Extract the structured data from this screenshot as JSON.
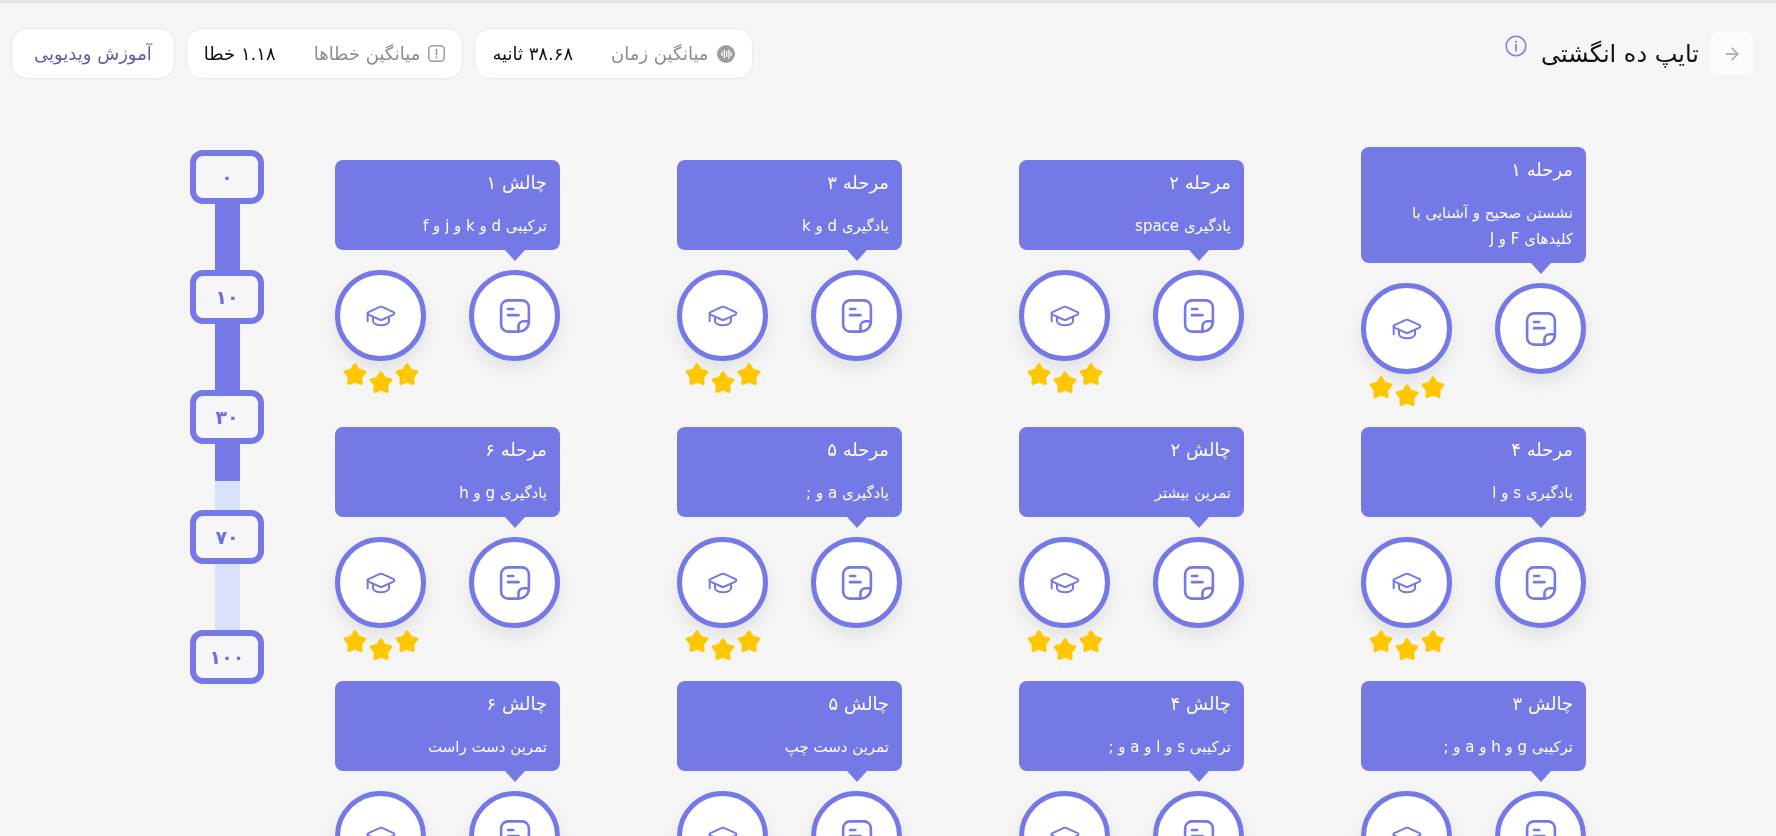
{
  "header": {
    "title": "تایپ ده انگشتی",
    "stats": [
      {
        "kind": "time",
        "label": "میانگین زمان",
        "value": "۳۸.۶۸ ثانیه"
      },
      {
        "kind": "errors",
        "label": "میانگین خطاها",
        "value": "۱.۱۸ خطا"
      }
    ],
    "video_button": "آموزش ویدیویی"
  },
  "stages": [
    {
      "title": "مرحله ۱",
      "subtitle": "نشستن صحیح و آشنایی با کلیدهای F و J",
      "stars": 3
    },
    {
      "title": "مرحله ۲",
      "subtitle": "یادگیری space",
      "stars": 3
    },
    {
      "title": "مرحله ۳",
      "subtitle": "یادگیری d و k",
      "stars": 3
    },
    {
      "title": "چالش ۱",
      "subtitle": "ترکیبی d و k و j و f",
      "stars": 3
    },
    {
      "title": "مرحله ۴",
      "subtitle": "یادگیری s و l",
      "stars": 3
    },
    {
      "title": "چالش ۲",
      "subtitle": "تمرین بیشتر",
      "stars": 3
    },
    {
      "title": "مرحله ۵",
      "subtitle": "یادگیری a و ;",
      "stars": 3
    },
    {
      "title": "مرحله ۶",
      "subtitle": "یادگیری g و h",
      "stars": 3
    },
    {
      "title": "چالش ۳",
      "subtitle": "ترکیبی g و h و a و ;"
    },
    {
      "title": "چالش ۴",
      "subtitle": "ترکیبی s و l و a و ;"
    },
    {
      "title": "چالش ۵",
      "subtitle": "تمرین دست چپ"
    },
    {
      "title": "چالش ۶",
      "subtitle": "تمرین دست راست"
    }
  ],
  "progress": {
    "level": 0.62,
    "marks": [
      "۰",
      "۱۰",
      "۳۰",
      "۷۰",
      "۱۰۰"
    ]
  }
}
